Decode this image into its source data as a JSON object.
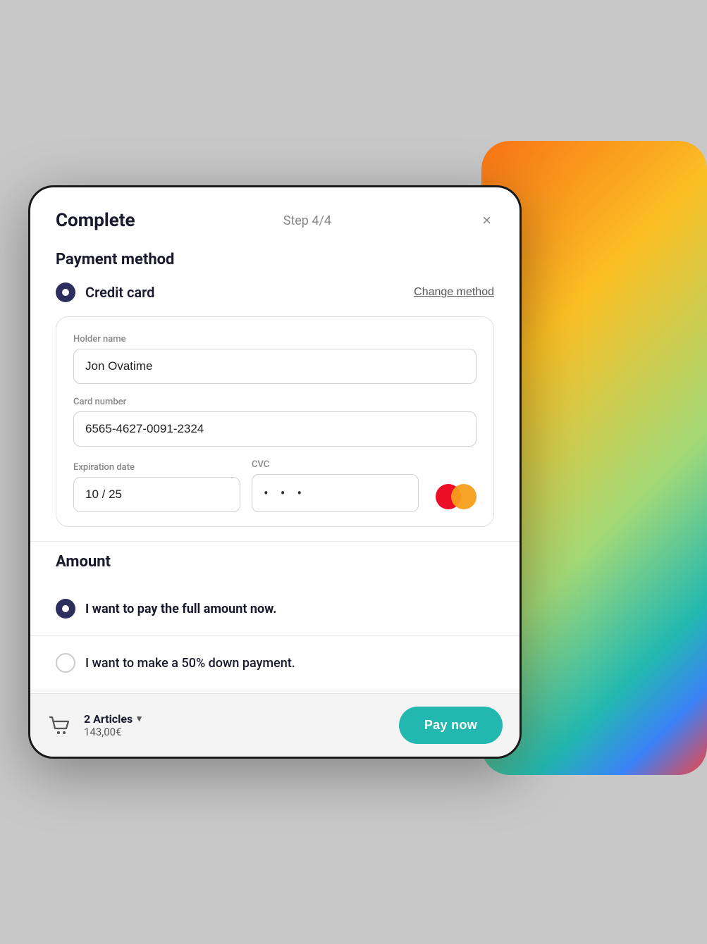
{
  "header": {
    "title": "Complete",
    "step": "Step 4/4",
    "close_label": "×"
  },
  "payment": {
    "section_title": "Payment method",
    "selected_method": "Credit card",
    "change_method_link": "Change method",
    "form": {
      "holder_name_label": "Holder name",
      "holder_name_value": "Jon Ovatime",
      "holder_name_placeholder": "Jon Ovatime",
      "card_number_label": "Card number",
      "card_number_value": "6565-4627-0091-2324",
      "expiration_label": "Expiration date",
      "expiration_value": "10 / 25",
      "cvc_label": "CVC",
      "cvc_dots": "• • •"
    }
  },
  "amount": {
    "section_title": "Amount",
    "option1_label": "I want to pay the full amount now.",
    "option2_label": "I want to make a 50% down payment."
  },
  "footer": {
    "articles_count": "2 Articles",
    "price": "143,00€",
    "pay_button_label": "Pay now",
    "cart_icon": "🛒"
  },
  "colors": {
    "primary_dark": "#2d2d5e",
    "teal": "#22b8b0",
    "mc_red": "#eb001b",
    "mc_orange": "#f79e1b"
  }
}
